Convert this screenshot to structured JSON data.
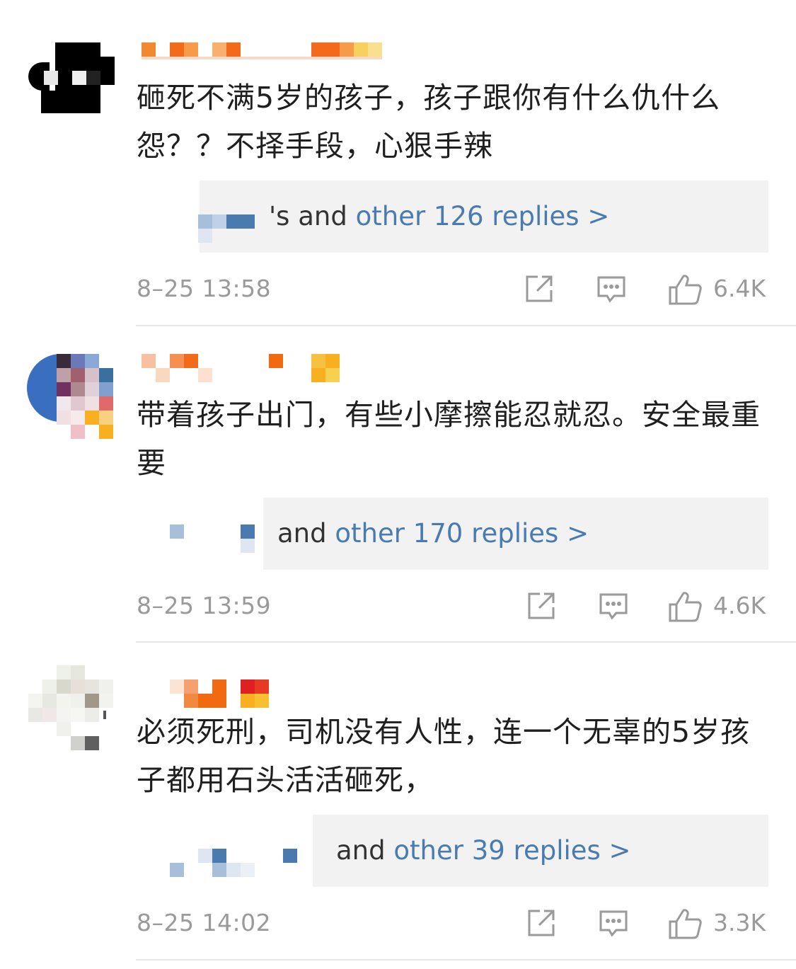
{
  "comments": [
    {
      "text": "砸死不满5岁的孩子，孩子跟你有什么仇什么怨？？不择手段，心狠手辣",
      "reply_prefix": "'s and ",
      "reply_link": "other 126 replies >",
      "time": "8–25 13:58",
      "likes": "6.4K"
    },
    {
      "text": "带着孩子出门，有些小摩擦能忍就忍。安全最重要",
      "reply_prefix": "and ",
      "reply_link": "other 170 replies >",
      "time": "8–25 13:59",
      "likes": "4.6K"
    },
    {
      "text": "必须死刑，司机没有人性，连一个无辜的5岁孩子都用石头活活砸死，",
      "reply_prefix": "and ",
      "reply_link": "other 39 replies >",
      "time": "8–25 14:02",
      "likes": "3.3K"
    }
  ],
  "icons": {
    "share": "share-icon",
    "comment": "comment-icon",
    "like": "thumbs-up-icon"
  },
  "colors": {
    "link": "#4a7bb0",
    "meta": "#9a9a9a",
    "reply_bg": "#f2f2f2",
    "divider": "#e6e6e6"
  }
}
